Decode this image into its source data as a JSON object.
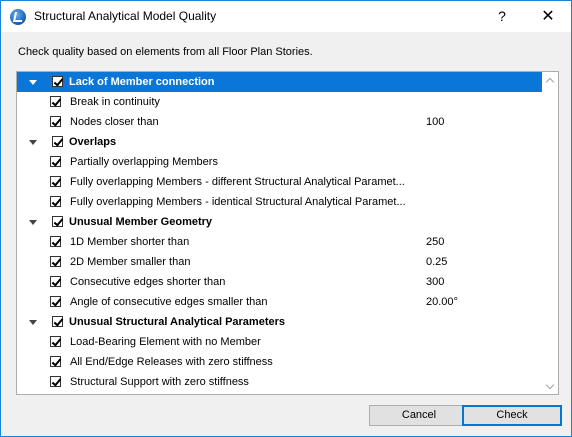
{
  "window": {
    "title": "Structural Analytical Model Quality",
    "help_label": "?",
    "close_label": "✕"
  },
  "instruction": "Check quality based on elements from all Floor Plan Stories.",
  "tree": [
    {
      "type": "group",
      "label": "Lack of Member connection",
      "checked": true,
      "selected": true
    },
    {
      "type": "item",
      "label": "Break in continuity",
      "checked": true,
      "value": ""
    },
    {
      "type": "item",
      "label": "Nodes closer than",
      "checked": true,
      "value": "100"
    },
    {
      "type": "group",
      "label": "Overlaps",
      "checked": true
    },
    {
      "type": "item",
      "label": "Partially overlapping Members",
      "checked": true,
      "value": ""
    },
    {
      "type": "item",
      "label": "Fully overlapping Members - different Structural Analytical Paramet...",
      "checked": true,
      "value": ""
    },
    {
      "type": "item",
      "label": "Fully overlapping Members - identical Structural Analytical Paramet...",
      "checked": true,
      "value": ""
    },
    {
      "type": "group",
      "label": "Unusual Member Geometry",
      "checked": true
    },
    {
      "type": "item",
      "label": "1D Member shorter than",
      "checked": true,
      "value": "250"
    },
    {
      "type": "item",
      "label": "2D Member smaller than",
      "checked": true,
      "value": "0.25"
    },
    {
      "type": "item",
      "label": "Consecutive edges shorter than",
      "checked": true,
      "value": "300"
    },
    {
      "type": "item",
      "label": "Angle of consecutive edges smaller than",
      "checked": true,
      "value": "20.00°"
    },
    {
      "type": "group",
      "label": "Unusual Structural Analytical Parameters",
      "checked": true
    },
    {
      "type": "item",
      "label": "Load-Bearing Element with no Member",
      "checked": true,
      "value": ""
    },
    {
      "type": "item",
      "label": "All End/Edge Releases with zero stiffness",
      "checked": true,
      "value": ""
    },
    {
      "type": "item",
      "label": "Structural Support with zero stiffness",
      "checked": true,
      "value": ""
    }
  ],
  "buttons": {
    "cancel_label": "Cancel",
    "check_label": "Check"
  },
  "colors": {
    "selection": "#0a76d8",
    "window_border": "#1883d7"
  }
}
